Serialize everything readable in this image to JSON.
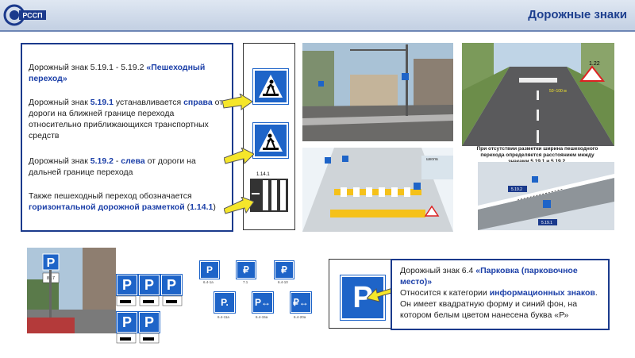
{
  "header": {
    "title": "Дорожные знаки",
    "logo_text": "РССП"
  },
  "left_panel": {
    "p1_prefix": "Дорожный знак 5.19.1 - 5.19.2 ",
    "p1_name": "«Пешеходный переход»",
    "p2_a": "Дорожный знак ",
    "p2_code": "5.19.1",
    "p2_b": " устанавливается ",
    "p2_side": "справа",
    "p2_c": " от дороги на ближней границе перехода относительно приближающихся транспортных средств",
    "p3_a": "Дорожный знак ",
    "p3_code": "5.19.2",
    "p3_b": " - ",
    "p3_side": "слева",
    "p3_c": " от дороги на дальней границе перехода",
    "p4_a": "Также пешеходный переход обозначается ",
    "p4_mark": "горизонтальной дорожной разметкой",
    "p4_b": " (",
    "p4_code": "1.14.1",
    "p4_c": ")",
    "marking_label": "1.14.1"
  },
  "figures": {
    "caption_text": "При отсутствии разметки ширина пешеходного перехода определяется расстоянием между знаками 5.19.1 и 5.19.2.",
    "label_a": "5.19.2",
    "label_b": "5.19.1",
    "dist_label": "50~100 м",
    "school_label": "школа",
    "sign_num": "1.22",
    "parking_sub": "8.17",
    "parking_sub2": "8.2.1"
  },
  "parking_signs": [
    {
      "code": "6.4",
      "sub": "6.4-1a"
    },
    {
      "code": "₽",
      "sub": "7.1"
    },
    {
      "code": "₽",
      "sub": "6.4-10"
    },
    {
      "code": "P.",
      "sub": "6.4-11a"
    },
    {
      "code": "P↔",
      "sub": "6.4-15a"
    },
    {
      "code": "₽↔",
      "sub": "6.4-20a"
    }
  ],
  "right_panel": {
    "p1_a": "Дорожный знак 6.4 ",
    "p1_name": "«Парковка (парковочное место)»",
    "p2_a": "Относится к категории ",
    "p2_cat": "информационных знаков",
    "p2_b": ". Он имеет квадратную форму и синий фон, на котором белым цветом нанесена буква «Р»",
    "sign_letter": "P"
  },
  "colors": {
    "accent": "#1b3fa8",
    "sign_blue": "#1e64c8",
    "arrow_yellow": "#f5e62a"
  }
}
